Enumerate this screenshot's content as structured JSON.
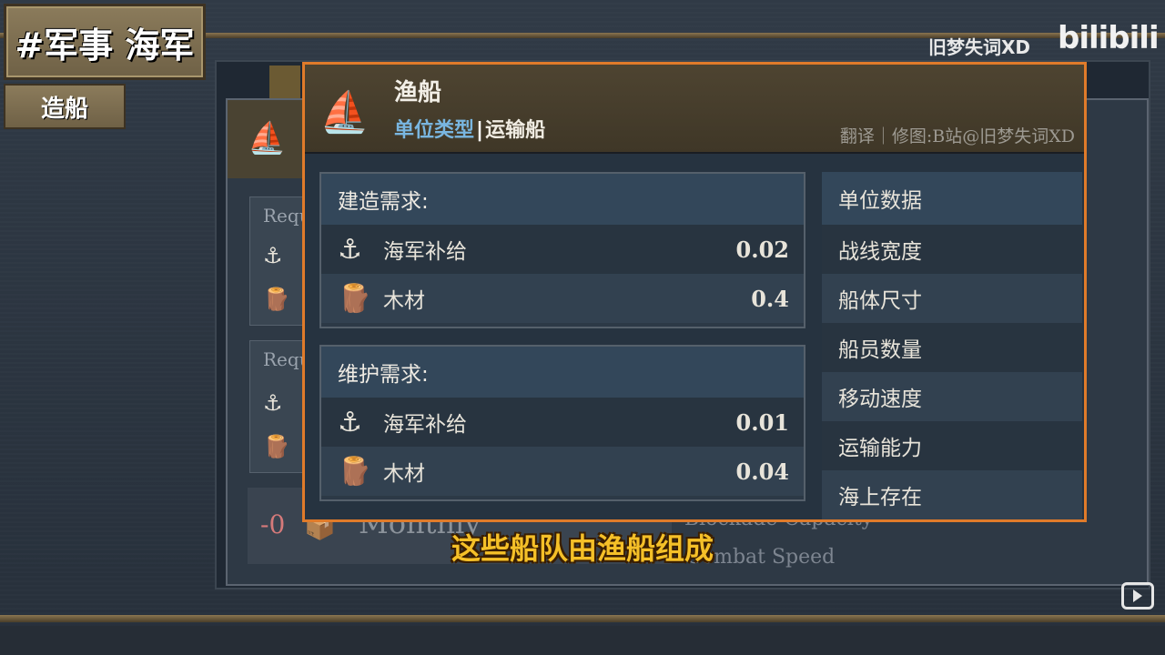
{
  "tags": {
    "main": "#军事 海军",
    "sub": "造船"
  },
  "watermark": {
    "text": "旧梦失词XD",
    "logo": "bilibili"
  },
  "background": {
    "req_label": "Requ",
    "monthly_value": "-0",
    "monthly_label": "Monthly",
    "hidden_stat_1": "Blockade Capacity",
    "hidden_stat_2": "Combat Speed"
  },
  "tooltip": {
    "title": "渔船",
    "type_key": "单位类型",
    "type_sep": "|",
    "type_value": "运输船",
    "credit": "翻译｜修图:B站@旧梦失词XD",
    "build": {
      "header": "建造需求:",
      "rows": [
        {
          "icon": "naval-supply-icon",
          "name": "海军补给",
          "value": "0.02"
        },
        {
          "icon": "timber-icon",
          "name": "木材",
          "value": "0.4"
        }
      ]
    },
    "maintain": {
      "header": "维护需求:",
      "rows": [
        {
          "icon": "naval-supply-icon",
          "name": "海军补给",
          "value": "0.01"
        },
        {
          "icon": "timber-icon",
          "name": "木材",
          "value": "0.04"
        }
      ]
    },
    "stats": {
      "header": "单位数据",
      "rows": [
        "战线宽度",
        "船体尺寸",
        "船员数量",
        "移动速度",
        "运输能力",
        "海上存在"
      ]
    }
  },
  "subtitle": "这些船队由渔船组成",
  "colors": {
    "accent_border": "#e07b2a",
    "subtitle": "#f5c028",
    "type_key": "#79b6e0"
  }
}
